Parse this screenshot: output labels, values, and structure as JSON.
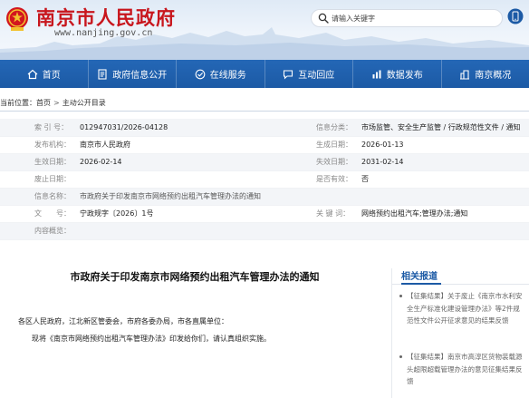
{
  "header": {
    "site_name": "南京市人民政府",
    "site_url": "www.nanjing.gov.cn",
    "search_placeholder": "请输入关键字",
    "brand_color": "#c8161d",
    "nav_color": "#1c5aa5"
  },
  "nav": [
    {
      "label": "首页",
      "icon": "home-icon"
    },
    {
      "label": "政府信息公开",
      "icon": "document-icon"
    },
    {
      "label": "在线服务",
      "icon": "service-icon"
    },
    {
      "label": "互动回应",
      "icon": "chat-icon"
    },
    {
      "label": "数据发布",
      "icon": "data-icon"
    },
    {
      "label": "南京概况",
      "icon": "building-icon"
    }
  ],
  "breadcrumb": {
    "prefix": "当前位置：",
    "items": [
      "首页",
      "主动公开目录"
    ],
    "separator": ">"
  },
  "info": {
    "index_no": {
      "label": "索 引 号：",
      "value": "012947031/2026-04128"
    },
    "category": {
      "label": "信息分类：",
      "value": "市场监管、安全生产监管 / 行政规范性文件 / 通知"
    },
    "publisher": {
      "label": "发布机构：",
      "value": "南京市人民政府"
    },
    "created": {
      "label": "生成日期：",
      "value": "2026-01-13"
    },
    "effective": {
      "label": "生效日期：",
      "value": "2026-02-14"
    },
    "expires": {
      "label": "失效日期：",
      "value": "2031-02-14"
    },
    "repeal": {
      "label": "废止日期：",
      "value": ""
    },
    "is_expired": {
      "label": "是否有效：",
      "value": "否"
    },
    "name": {
      "label": "信息名称：",
      "value": "市政府关于印发南京市网络预约出租汽车管理办法的通知"
    },
    "doc_no": {
      "label": "文　　号：",
      "value": "宁政规字〔2026〕1号"
    },
    "keywords": {
      "label": "关 键 词：",
      "value": "网络预约出租汽车;管理办法;通知"
    },
    "summary": {
      "label": "内容概览：",
      "value": ""
    }
  },
  "article": {
    "title": "市政府关于印发南京市网络预约出租汽车管理办法的通知",
    "salutation": "各区人民政府，江北新区管委会，市府各委办局，市各直属单位：",
    "body": "现将《南京市网络预约出租汽车管理办法》印发给你们，请认真组织实施。"
  },
  "related": {
    "title": "相关报道",
    "items": [
      "【征集结果】关于废止《南京市水利安全生产标准化建设管理办法》等2件规范性文件公开征求意见的结果反馈",
      "【征集结果】南京市高淳区货物装载源头超限超载管理办法的意见征集结果反馈"
    ]
  }
}
